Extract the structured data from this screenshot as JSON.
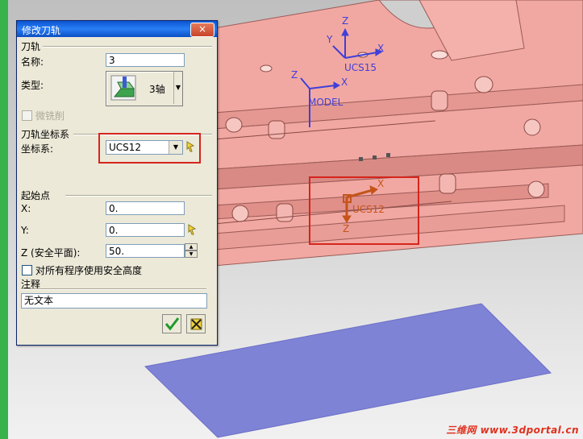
{
  "dialog": {
    "title": "修改刀轨",
    "close_label": "×",
    "section_toolpath": "刀轨",
    "name_label": "名称:",
    "name_value": "3",
    "type_label": "类型:",
    "type_value": "3轴",
    "micro_milling_label": "微铣削",
    "section_coord": "刀轨坐标系",
    "coord_label": "坐标系:",
    "coord_value": "UCS12",
    "section_start": "起始点",
    "x_label": "X:",
    "x_value": "0.",
    "y_label": "Y:",
    "y_value": "0.",
    "z_label": "Z (安全平面):",
    "z_value": "50.",
    "safe_height_label": "对所有程序使用安全高度",
    "section_note": "注释",
    "note_value": "无文本"
  },
  "viewport": {
    "ucs_top_label": "UCS15",
    "ucs_top_z": "Z",
    "ucs_top_y": "Y",
    "ucs_top_x": "X",
    "model_label": "MODEL",
    "model_z": "Z",
    "model_x": "X",
    "ucs_active_label": "UCS12",
    "ucs_active_x": "X",
    "ucs_active_z": "Z"
  },
  "watermark": {
    "brand": "三维网",
    "site": "www.3dportal.cn"
  },
  "colors": {
    "part_fill": "#f0a5a0",
    "plane_fill": "#7f83d6",
    "highlight_red": "#d4251d",
    "axis_blue": "#4040d8",
    "active_axis": "#c4541b"
  }
}
